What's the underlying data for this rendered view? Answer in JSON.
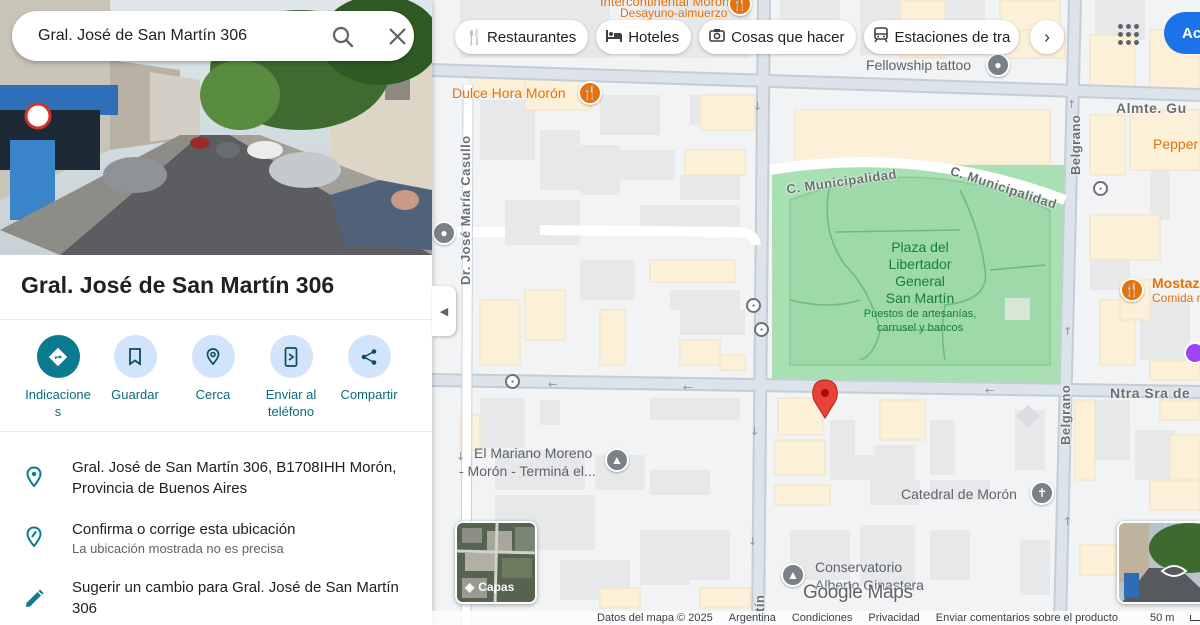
{
  "search": {
    "value": "Gral. José de San Martín 306"
  },
  "place": {
    "title": "Gral. José de San Martín 306"
  },
  "actions": [
    {
      "name": "directions",
      "label": "Indicacione\ns"
    },
    {
      "name": "save",
      "label": "Guardar"
    },
    {
      "name": "nearby",
      "label": "Cerca"
    },
    {
      "name": "send-to-phone",
      "label": "Enviar al\nteléfono"
    },
    {
      "name": "share",
      "label": "Compartir"
    }
  ],
  "info": {
    "address": "Gral. José de San Martín 306, B1708IHH Morón, Provincia de Buenos Aires",
    "confirm_title": "Confirma o corrige esta ubicación",
    "confirm_sub": "La ubicación mostrada no es precisa",
    "suggest": "Sugerir un cambio para Gral. José de San Martín 306"
  },
  "chips": {
    "restaurants": "Restaurantes",
    "hotels": "Hoteles",
    "things_to_do": "Cosas que hacer",
    "transit": "Estaciones de tra"
  },
  "signin_label": "Ac",
  "map": {
    "streets": {
      "casullo": "Dr. José María Casullo",
      "municipalidad_1": "C. Municipalidad",
      "municipalidad_2": "C. Municipalidad",
      "belgrano_top": "Belgrano",
      "belgrano_bottom": "Belgrano",
      "almte": "Almte. Gu",
      "ntra_sra": "Ntra Sra de",
      "martin_bottom": "tín"
    },
    "pois": {
      "desayuno": "Desayuno-almuerzo",
      "fellowship": "Fellowship tattoo",
      "dulce_hora": "Dulce Hora Morón",
      "pepper": "Pepper",
      "mostaza": "Mostaz",
      "mostaza_sub": "Comida r",
      "mariano_1": "El Mariano Moreno",
      "mariano_2": "- Morón - Terminá el...",
      "catedral": "Catedral de Morón",
      "conservatorio_1": "Conservatorio",
      "conservatorio_2": "Alberto Ginastera",
      "partial_top": "Intercontinental Morón"
    },
    "park": {
      "name_1": "Plaza del",
      "name_2": "Libertador",
      "name_3": "General",
      "name_4": "San Martín",
      "sub_1": "Puestos de artesanías,",
      "sub_2": "carrusel y bancos"
    },
    "layers_label": "Capas",
    "google_logo": "Google Maps"
  },
  "footer": {
    "map_data": "Datos del mapa © 2025",
    "country": "Argentina",
    "terms": "Condiciones",
    "privacy": "Privacidad",
    "feedback": "Enviar comentarios sobre el producto",
    "scale": "50 m"
  },
  "colors": {
    "accent_teal": "#0b7b8f",
    "action_bg": "#d2e3fc",
    "pin_red": "#ea4335",
    "park_green": "#a8e0b3",
    "poi_orange": "#e8710a",
    "signin_blue": "#1a73e8"
  }
}
